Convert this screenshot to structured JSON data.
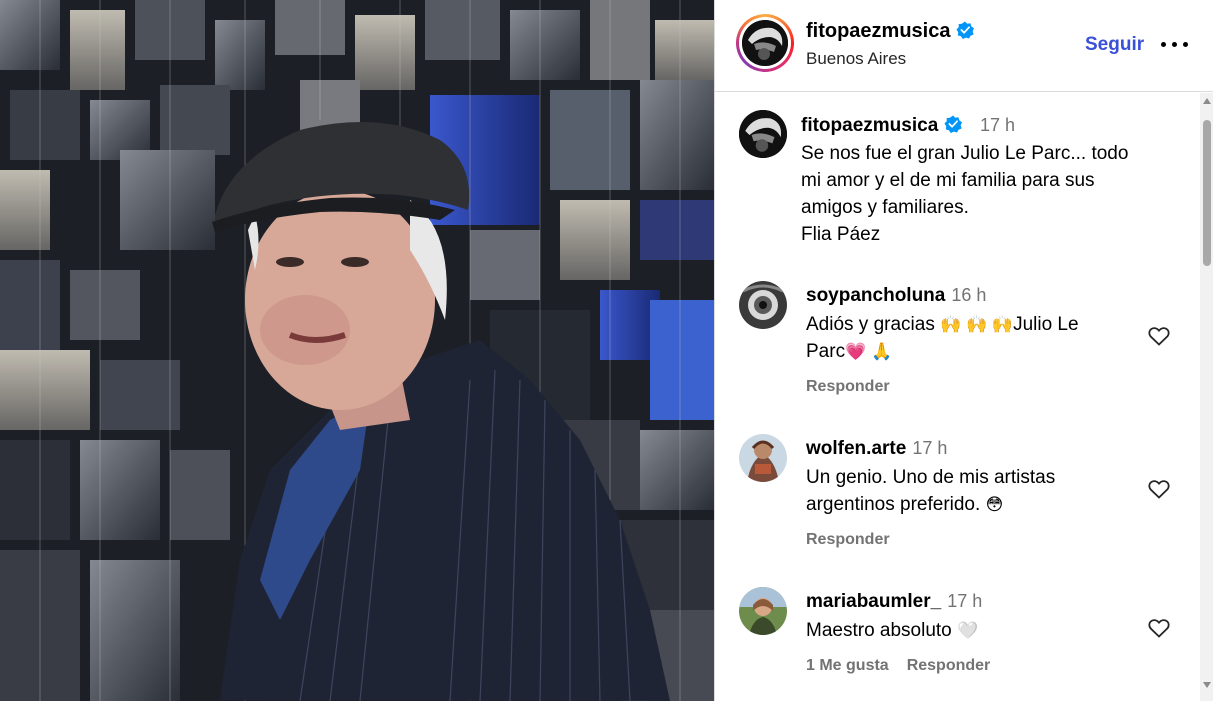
{
  "post": {
    "username": "fitopaezmusica",
    "location": "Buenos Aires",
    "follow_label": "Seguir",
    "more_label": "Más opciones"
  },
  "caption": {
    "username": "fitopaezmusica",
    "time": "17 h",
    "lines": [
      "Se nos fue el gran Julio Le Parc... todo",
      "mi amor y el de mi familia para sus",
      "amigos y familiares.",
      "Flia Páez"
    ]
  },
  "comments": [
    {
      "username": "soypancholuna",
      "time": "16 h",
      "line1": "Adiós y gracias ",
      "line1_emoji": "🙌 🙌 🙌",
      "line1_tail": "Julio Le",
      "line2": "Parc",
      "line2_emoji": "💗 🙏",
      "reply_label": "Responder"
    },
    {
      "username": "wolfen.arte",
      "time": "17 h",
      "line1": "Un genio. Uno de mis artistas",
      "line2": "argentinos preferido. ",
      "line2_emoji": "😳",
      "reply_label": "Responder"
    },
    {
      "username": "mariabaumler_",
      "time": "17 h",
      "line1": "Maestro absoluto ",
      "line1_emoji": "🤍",
      "likes_label": "1 Me gusta",
      "reply_label": "Responder"
    }
  ],
  "colors": {
    "follow": "#3a50d8",
    "verified": "#0095f6",
    "secondary_text": "#737373"
  },
  "icons": [
    "verified-badge-icon",
    "more-options-icon",
    "heart-icon"
  ]
}
